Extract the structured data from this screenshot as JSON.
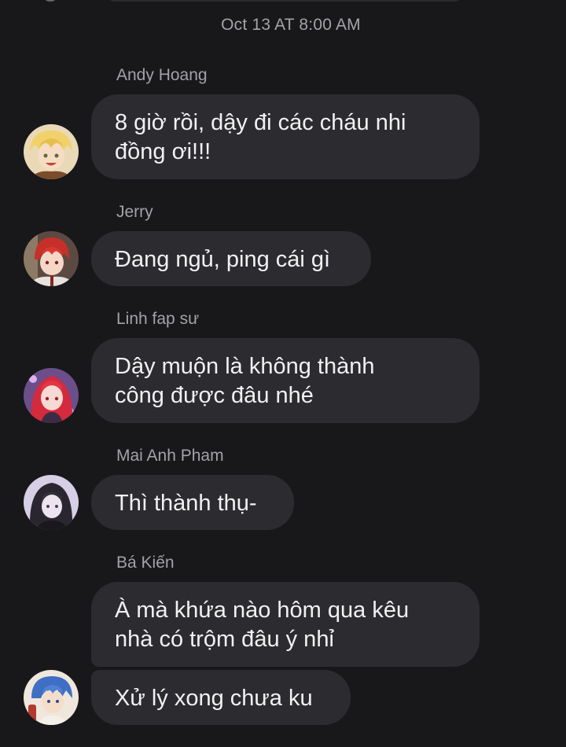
{
  "conversation": {
    "timestamp": "Oct 13 AT 8:00 AM",
    "messages": [
      {
        "sender": "Andy Hoang",
        "lines": [
          "8 giờ rồi, dậy đi các cháu nhi",
          "đồng ơi!!!"
        ],
        "avatar_icon": "avatar-blonde-anime-boy-icon"
      },
      {
        "sender": "Jerry",
        "lines": [
          "Đang ngủ, ping cái gì"
        ],
        "avatar_icon": "avatar-redhead-anime-boy-icon"
      },
      {
        "sender": "Linh fap sư",
        "lines": [
          "Dậy muộn là không thành",
          "công được đâu nhé"
        ],
        "avatar_icon": "avatar-redhead-anime-girl-icon"
      },
      {
        "sender": "Mai Anh Pham",
        "lines": [
          "Thì thành thụ-"
        ],
        "avatar_icon": "avatar-hooded-anime-girl-icon"
      },
      {
        "sender": "Bá Kiến",
        "lines": [
          "À mà khứa nào hôm qua kêu",
          "nhà có trộm đâu ý nhỉ"
        ],
        "avatar_icon": null
      },
      {
        "sender": null,
        "lines": [
          "Xử lý xong chưa ku"
        ],
        "avatar_icon": "avatar-blue-hair-anime-boy-icon"
      }
    ]
  },
  "colors": {
    "background": "#18171a",
    "bubble": "#2c2b30",
    "message_text": "#f1f1f1",
    "meta_text": "#a3a2a7"
  }
}
